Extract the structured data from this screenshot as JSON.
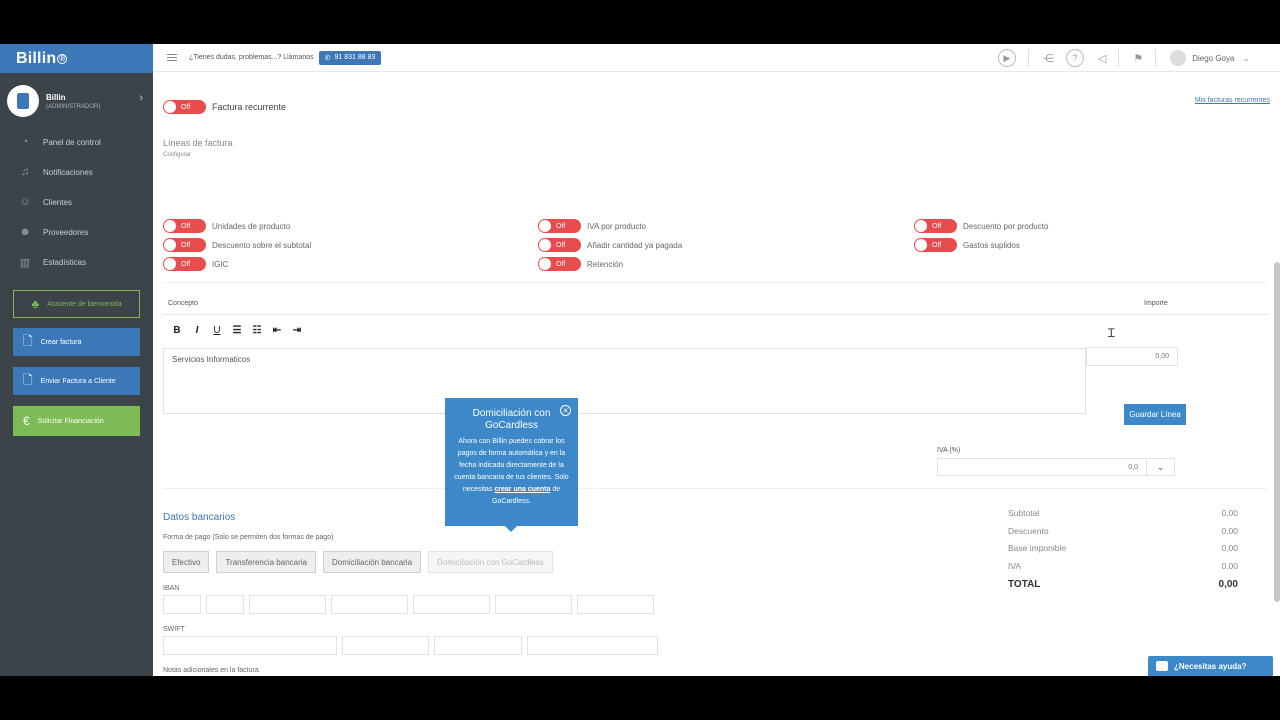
{
  "sidebar": {
    "brand": "Billin",
    "brand_mark": "®",
    "account_name": "Billin",
    "account_role": "(ADMINISTRADOR)",
    "nav": [
      {
        "label": "Panel de control",
        "icon": "dashboard-icon",
        "glyph": "◔"
      },
      {
        "label": "Notificaciones",
        "icon": "bell-icon",
        "glyph": "♫"
      },
      {
        "label": "Clientes",
        "icon": "users-icon",
        "glyph": "☺"
      },
      {
        "label": "Proveedores",
        "icon": "suppliers-icon",
        "glyph": "☻"
      },
      {
        "label": "Estadísticas",
        "icon": "stats-icon",
        "glyph": "▥"
      }
    ],
    "welcome_btn": "Asistente de bienvenida",
    "create_invoice_btn": "Crear factura",
    "send_invoice_btn": "Enviar Factura a Cliente",
    "financing_btn": "Solicitar Financiación"
  },
  "topbar": {
    "help_text": "¿Tienes dudas, problemas...? Llámanos",
    "phone": "91 831 88 83",
    "user_name": "Diego Goya"
  },
  "main": {
    "recurrent_label": "Factura recurrente",
    "toggle_off": "Off",
    "my_recurrent_link": "Mis facturas recurrentes",
    "lines_title": "Líneas de factura",
    "configure": "Configurar",
    "options": [
      "Unidades de producto",
      "IVA por producto",
      "Descuento por producto",
      "Descuento sobre el subtotal",
      "Añadir cantidad ya pagada",
      "Gastos suplidos",
      "IGIC",
      "Retención"
    ],
    "concept_label": "Concepto",
    "amount_label": "Importe",
    "editor_text": "Servicios Informaticos",
    "amount_value": "0,00",
    "save_line": "Guardar Línea",
    "iva_label": "IVA (%)",
    "iva_value": "0,0",
    "bank_title": "Datos bancarios",
    "payment_label": "Forma de pago (Solo se permiten dos formas de pago)",
    "payment_methods": [
      "Efectivo",
      "Transferencia bancaria",
      "Domiciliación bancaria",
      "Domiciliación con GoCardless"
    ],
    "iban_label": "IBAN",
    "swift_label": "SWIFT",
    "notes_label": "Notas adicionales en la factura",
    "totals": [
      {
        "label": "Subtotal",
        "value": "0,00"
      },
      {
        "label": "Descuento",
        "value": "0,00"
      },
      {
        "label": "Base imponible",
        "value": "0,00"
      },
      {
        "label": "IVA",
        "value": "0,00"
      }
    ],
    "total_label": "TOTAL",
    "total_value": "0,00"
  },
  "tooltip": {
    "title": "Domiciliación con GoCardless",
    "body_before": "Ahora con Billin puedes cobrar los pagos de forma automática y en la fecha indicada directamente de la cuenta bancaria de tus clientes. Solo necesitas ",
    "link": "crear una cuenta",
    "body_after": " de GoCardless."
  },
  "help_chat": "¿Necesitas ayuda?",
  "colors": {
    "brand_blue": "#3c78b8",
    "toggle_off": "#e84c4c",
    "green": "#7dbb57",
    "sidebar": "#3c4349"
  }
}
